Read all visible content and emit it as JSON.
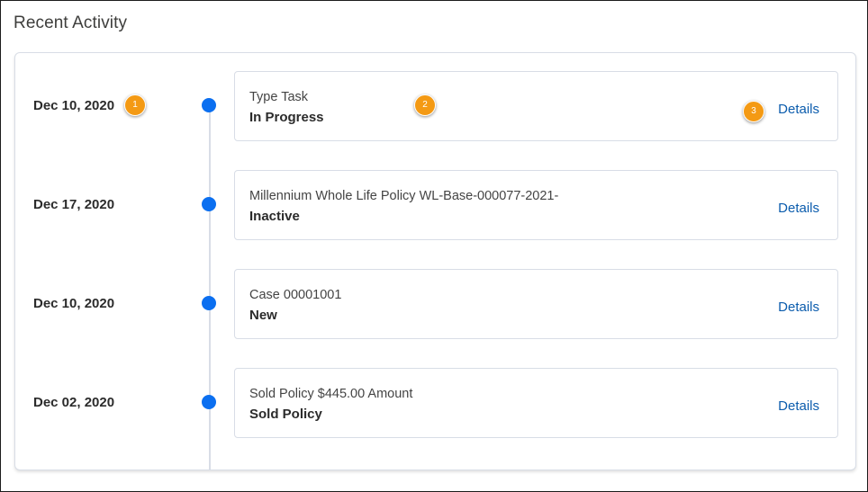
{
  "section": {
    "title": "Recent Activity"
  },
  "activities": [
    {
      "date": "Dec 10, 2020",
      "title": "Type Task",
      "status": "In Progress",
      "link_label": "Details"
    },
    {
      "date": "Dec 17, 2020",
      "title": "Millennium Whole Life Policy WL-Base-000077-2021-",
      "status": "Inactive",
      "link_label": "Details"
    },
    {
      "date": "Dec 10, 2020",
      "title": "Case 00001001",
      "status": "New",
      "link_label": "Details"
    },
    {
      "date": "Dec 02, 2020",
      "title": "Sold Policy $445.00 Amount",
      "status": "Sold Policy",
      "link_label": "Details"
    }
  ],
  "callouts": [
    "1",
    "2",
    "3"
  ],
  "colors": {
    "timeline_dot": "#0b6ff0",
    "link": "#0b5cad",
    "callout_badge": "#f49a14",
    "border": "#d8dde6"
  }
}
